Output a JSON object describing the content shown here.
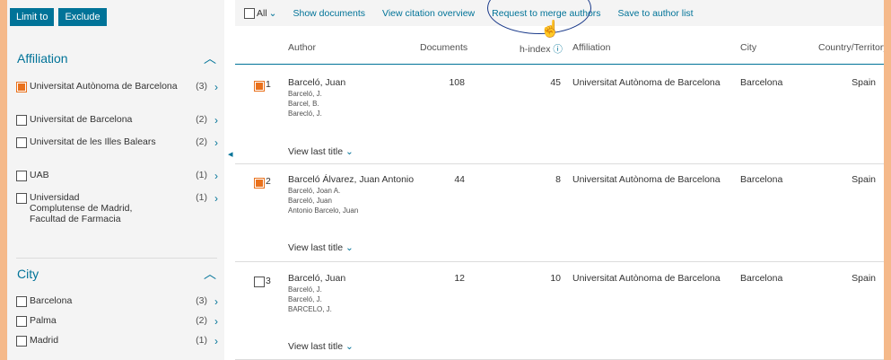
{
  "sidebar": {
    "limit_label": "Limit to",
    "exclude_label": "Exclude",
    "affiliation": {
      "title": "Affiliation",
      "items": [
        {
          "label": "Universitat Autònoma de Barcelona",
          "count": "(3)",
          "checked": true
        },
        {
          "label": "Universitat de Barcelona",
          "count": "(2)",
          "checked": false
        },
        {
          "label": "Universitat de les Illes Balears",
          "count": "(2)",
          "checked": false
        },
        {
          "label": "UAB",
          "count": "(1)",
          "checked": false
        },
        {
          "label": "Universidad Complutense de Madrid, Facultad de Farmacia",
          "count": "(1)",
          "checked": false
        }
      ]
    },
    "city": {
      "title": "City",
      "items": [
        {
          "label": "Barcelona",
          "count": "(3)",
          "checked": false
        },
        {
          "label": "Palma",
          "count": "(2)",
          "checked": false
        },
        {
          "label": "Madrid",
          "count": "(1)",
          "checked": false
        }
      ]
    }
  },
  "toolbar": {
    "all_label": "All",
    "show_documents": "Show documents",
    "view_citation": "View citation overview",
    "request_merge": "Request to merge authors",
    "save_list": "Save to author list"
  },
  "table": {
    "headers": {
      "author": "Author",
      "documents": "Documents",
      "hindex": "h-index",
      "affiliation": "Affiliation",
      "city": "City",
      "country": "Country/Territory"
    },
    "view_last_title": "View last title",
    "rows": [
      {
        "num": "1",
        "checked": true,
        "author": "Barceló, Juan",
        "variants": [
          "Barceló, J.",
          "Barcel, B.",
          "Barecló, J."
        ],
        "documents": "108",
        "hindex": "45",
        "affiliation": "Universitat Autònoma de Barcelona",
        "city": "Barcelona",
        "country": "Spain"
      },
      {
        "num": "2",
        "checked": true,
        "author": "Barceló Álvarez, Juan Antonio",
        "variants": [
          "Barceló, Joan A.",
          "Barceló, Juan",
          "Antonio Barcelo, Juan"
        ],
        "documents": "44",
        "hindex": "8",
        "affiliation": "Universitat Autònoma de Barcelona",
        "city": "Barcelona",
        "country": "Spain"
      },
      {
        "num": "3",
        "checked": false,
        "author": "Barceló, Juan",
        "variants": [
          "Barceló, J.",
          "Barceló, J.",
          "BARCELO, J."
        ],
        "documents": "12",
        "hindex": "10",
        "affiliation": "Universitat Autònoma de Barcelona",
        "city": "Barcelona",
        "country": "Spain"
      }
    ]
  },
  "colors": {
    "accent": "#007398",
    "checked": "#e9711c",
    "highlight_border": "#f5b98a"
  }
}
